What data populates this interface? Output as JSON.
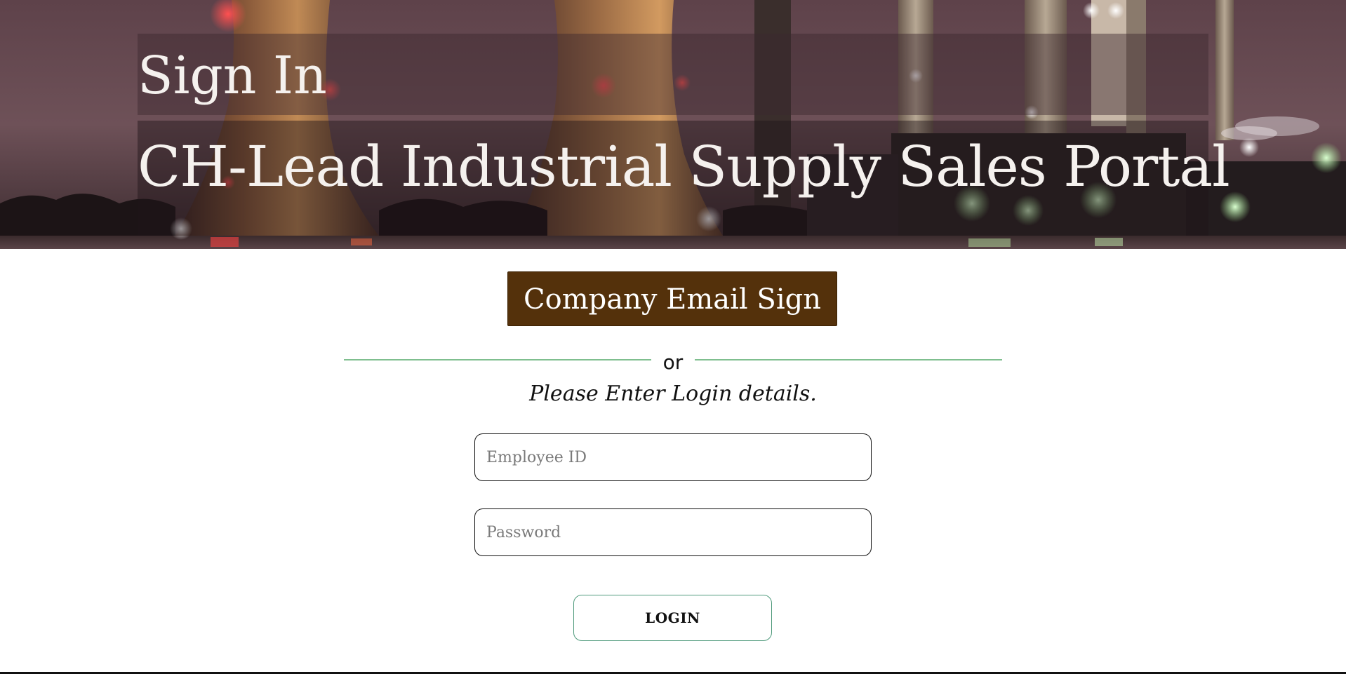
{
  "header": {
    "title": "Sign In",
    "subtitle": "CH-Lead Industrial Supply Sales Portal",
    "background_image": "industrial-power-plant-at-night"
  },
  "sso": {
    "button_label": "Company Email Sign In",
    "color": "#54310b"
  },
  "separator": {
    "text": "or",
    "line_color": "#7fbf8f"
  },
  "form": {
    "instructions": "Please Enter Login details.",
    "employee_id": {
      "placeholder": "Employee ID",
      "value": ""
    },
    "password": {
      "placeholder": "Password",
      "value": ""
    },
    "login_label": "LOGIN",
    "login_border_color": "#4f9a7c"
  }
}
